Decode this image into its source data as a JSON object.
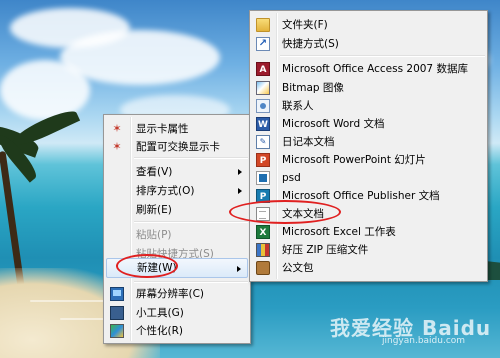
{
  "context_menu": {
    "items": [
      {
        "label": "显示卡属性",
        "icon": "display-card-icon",
        "enabled": true
      },
      {
        "label": "配置可交换显示卡",
        "icon": "display-card-icon",
        "enabled": true
      },
      {
        "label": "查看(V)",
        "submenu": true,
        "enabled": true
      },
      {
        "label": "排序方式(O)",
        "submenu": true,
        "enabled": true
      },
      {
        "label": "刷新(E)",
        "enabled": true
      },
      {
        "label": "粘贴(P)",
        "enabled": false
      },
      {
        "label": "粘贴快捷方式(S)",
        "enabled": false
      },
      {
        "label": "新建(W)",
        "submenu": true,
        "enabled": true,
        "highlighted": true
      },
      {
        "label": "屏幕分辨率(C)",
        "icon": "monitor-icon",
        "enabled": true
      },
      {
        "label": "小工具(G)",
        "icon": "gadget-icon",
        "enabled": true
      },
      {
        "label": "个性化(R)",
        "icon": "personalize-icon",
        "enabled": true
      }
    ]
  },
  "new_submenu": {
    "items": [
      {
        "label": "文件夹(F)",
        "icon": "folder-icon"
      },
      {
        "label": "快捷方式(S)",
        "icon": "shortcut-icon"
      },
      {
        "label": "Microsoft Office Access 2007 数据库",
        "icon": "access-icon"
      },
      {
        "label": "Bitmap 图像",
        "icon": "bitmap-icon"
      },
      {
        "label": "联系人",
        "icon": "contact-icon"
      },
      {
        "label": "Microsoft Word 文档",
        "icon": "word-icon"
      },
      {
        "label": "日记本文档",
        "icon": "journal-icon"
      },
      {
        "label": "Microsoft PowerPoint 幻灯片",
        "icon": "powerpoint-icon"
      },
      {
        "label": "psd",
        "icon": "psd-icon"
      },
      {
        "label": "Microsoft Office Publisher 文档",
        "icon": "publisher-icon"
      },
      {
        "label": "文本文档",
        "icon": "text-document-icon"
      },
      {
        "label": "Microsoft Excel 工作表",
        "icon": "excel-icon"
      },
      {
        "label": "好压 ZIP 压缩文件",
        "icon": "zip-icon"
      },
      {
        "label": "公文包",
        "icon": "briefcase-icon"
      }
    ]
  },
  "watermark": {
    "text": "我爱经验",
    "brand": "Baidu",
    "sub": "jingyan.baidu.com"
  },
  "colors": {
    "annotation": "#e02020",
    "menu_bg": "#f0f0f0",
    "highlight": "#dbeaf9"
  }
}
